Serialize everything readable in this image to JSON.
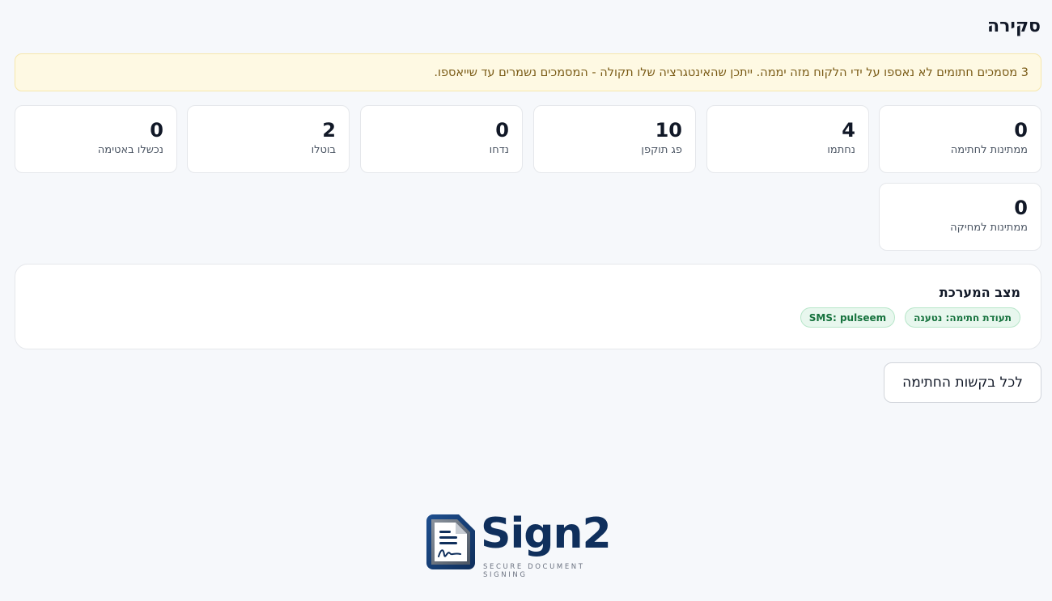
{
  "page": {
    "title": "סקירה"
  },
  "alert": {
    "text": "3 מסמכים חתומים לא נאספו על ידי הלקוח מזה יממה. ייתכן שהאינטגרציה שלו תקולה - המסמכים נשמרים עד שייאספו."
  },
  "stats": [
    {
      "value": "0",
      "label": "ממתינות לחתימה"
    },
    {
      "value": "4",
      "label": "נחתמו"
    },
    {
      "value": "10",
      "label": "פג תוקפן"
    },
    {
      "value": "0",
      "label": "נדחו"
    },
    {
      "value": "2",
      "label": "בוטלו"
    },
    {
      "value": "0",
      "label": "נכשלו באטימה"
    },
    {
      "value": "0",
      "label": "ממתינות למחיקה"
    }
  ],
  "system_status": {
    "title": "מצב המערכת",
    "badges": [
      {
        "label": "תעודת חתימה: נטענה"
      },
      {
        "label": "SMS: pulseem"
      }
    ],
    "badge_color": "#15723d"
  },
  "actions": {
    "all_requests_label": "לכל בקשות החתימה"
  },
  "logo": {
    "name": "Sign2",
    "tagline": "SECURE DOCUMENT SIGNING",
    "icon": "signed-document-icon"
  },
  "colors": {
    "alert_bg": "#fef9e3",
    "alert_text": "#7a5b16",
    "brand": "#0f2f5c"
  }
}
